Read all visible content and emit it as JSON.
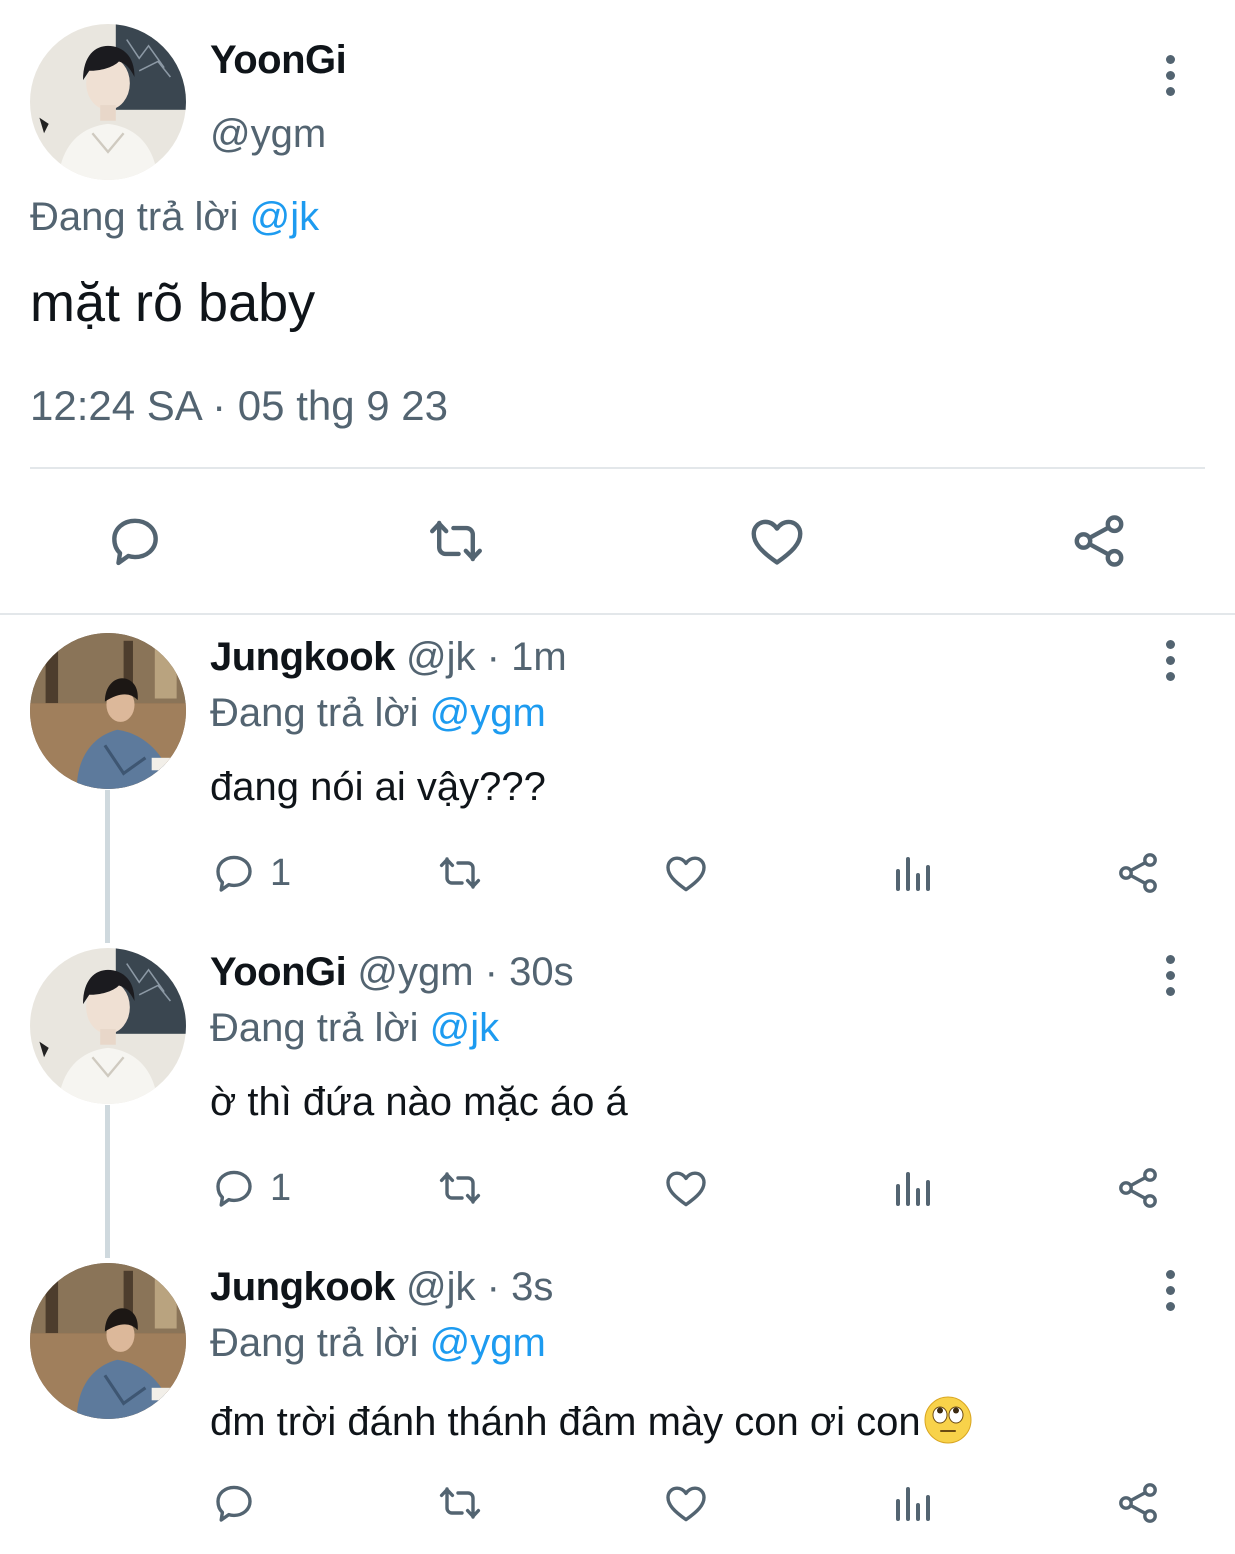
{
  "main": {
    "name": "YoonGi",
    "handle": "@ygm",
    "replying_prefix": "Đang trả lời ",
    "replying_to": "@jk",
    "text": "mặt rõ baby",
    "timestamp": "12:24 SA · 05 thg 9 23",
    "actions": [
      "reply-icon",
      "retweet-icon",
      "like-icon",
      "share-icon"
    ]
  },
  "replies": [
    {
      "name": "Jungkook",
      "handle": "@jk",
      "time": "· 1m",
      "replying_prefix": "Đang trả lời ",
      "replying_to": "@ygm",
      "text": "đang nói ai vậy???",
      "reply_count": "1"
    },
    {
      "name": "YoonGi",
      "handle": "@ygm",
      "time": "· 30s",
      "replying_prefix": "Đang trả lời ",
      "replying_to": "@jk",
      "text": "ờ thì đứa nào mặc áo á",
      "reply_count": "1"
    },
    {
      "name": "Jungkook",
      "handle": "@jk",
      "time": "· 3s",
      "replying_prefix": "Đang trả lời ",
      "replying_to": "@ygm",
      "text": "đm trời đánh thánh đâm mày con ơi con",
      "emoji": "face-with-rolling-eyes",
      "reply_count": ""
    }
  ],
  "colors": {
    "text": "#0f1419",
    "secondary": "#536471",
    "mention": "#1d9bf0",
    "divider": "#e3e7ea",
    "thread_line": "#cfd9de"
  }
}
